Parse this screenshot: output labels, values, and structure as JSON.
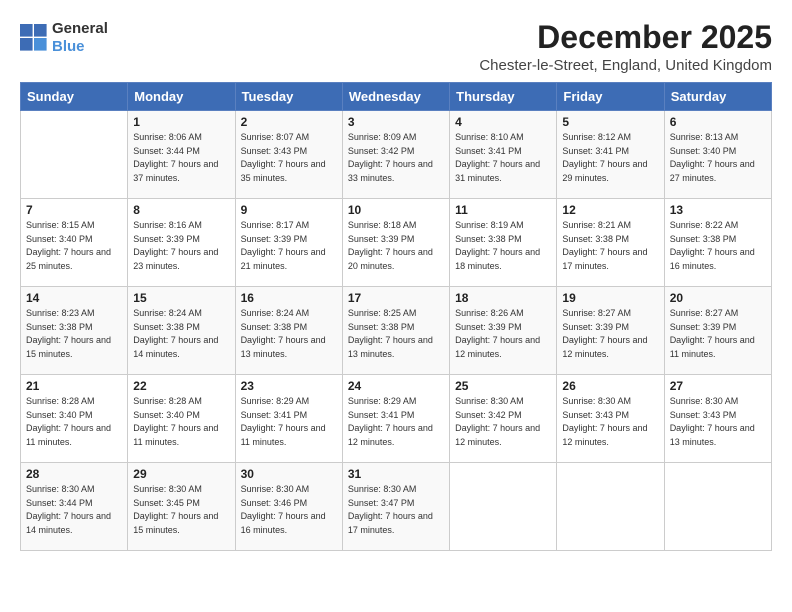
{
  "logo": {
    "general": "General",
    "blue": "Blue"
  },
  "header": {
    "title": "December 2025",
    "subtitle": "Chester-le-Street, England, United Kingdom"
  },
  "days_of_week": [
    "Sunday",
    "Monday",
    "Tuesday",
    "Wednesday",
    "Thursday",
    "Friday",
    "Saturday"
  ],
  "weeks": [
    [
      {
        "day": "",
        "sunrise": "",
        "sunset": "",
        "daylight": ""
      },
      {
        "day": "1",
        "sunrise": "Sunrise: 8:06 AM",
        "sunset": "Sunset: 3:44 PM",
        "daylight": "Daylight: 7 hours and 37 minutes."
      },
      {
        "day": "2",
        "sunrise": "Sunrise: 8:07 AM",
        "sunset": "Sunset: 3:43 PM",
        "daylight": "Daylight: 7 hours and 35 minutes."
      },
      {
        "day": "3",
        "sunrise": "Sunrise: 8:09 AM",
        "sunset": "Sunset: 3:42 PM",
        "daylight": "Daylight: 7 hours and 33 minutes."
      },
      {
        "day": "4",
        "sunrise": "Sunrise: 8:10 AM",
        "sunset": "Sunset: 3:41 PM",
        "daylight": "Daylight: 7 hours and 31 minutes."
      },
      {
        "day": "5",
        "sunrise": "Sunrise: 8:12 AM",
        "sunset": "Sunset: 3:41 PM",
        "daylight": "Daylight: 7 hours and 29 minutes."
      },
      {
        "day": "6",
        "sunrise": "Sunrise: 8:13 AM",
        "sunset": "Sunset: 3:40 PM",
        "daylight": "Daylight: 7 hours and 27 minutes."
      }
    ],
    [
      {
        "day": "7",
        "sunrise": "Sunrise: 8:15 AM",
        "sunset": "Sunset: 3:40 PM",
        "daylight": "Daylight: 7 hours and 25 minutes."
      },
      {
        "day": "8",
        "sunrise": "Sunrise: 8:16 AM",
        "sunset": "Sunset: 3:39 PM",
        "daylight": "Daylight: 7 hours and 23 minutes."
      },
      {
        "day": "9",
        "sunrise": "Sunrise: 8:17 AM",
        "sunset": "Sunset: 3:39 PM",
        "daylight": "Daylight: 7 hours and 21 minutes."
      },
      {
        "day": "10",
        "sunrise": "Sunrise: 8:18 AM",
        "sunset": "Sunset: 3:39 PM",
        "daylight": "Daylight: 7 hours and 20 minutes."
      },
      {
        "day": "11",
        "sunrise": "Sunrise: 8:19 AM",
        "sunset": "Sunset: 3:38 PM",
        "daylight": "Daylight: 7 hours and 18 minutes."
      },
      {
        "day": "12",
        "sunrise": "Sunrise: 8:21 AM",
        "sunset": "Sunset: 3:38 PM",
        "daylight": "Daylight: 7 hours and 17 minutes."
      },
      {
        "day": "13",
        "sunrise": "Sunrise: 8:22 AM",
        "sunset": "Sunset: 3:38 PM",
        "daylight": "Daylight: 7 hours and 16 minutes."
      }
    ],
    [
      {
        "day": "14",
        "sunrise": "Sunrise: 8:23 AM",
        "sunset": "Sunset: 3:38 PM",
        "daylight": "Daylight: 7 hours and 15 minutes."
      },
      {
        "day": "15",
        "sunrise": "Sunrise: 8:24 AM",
        "sunset": "Sunset: 3:38 PM",
        "daylight": "Daylight: 7 hours and 14 minutes."
      },
      {
        "day": "16",
        "sunrise": "Sunrise: 8:24 AM",
        "sunset": "Sunset: 3:38 PM",
        "daylight": "Daylight: 7 hours and 13 minutes."
      },
      {
        "day": "17",
        "sunrise": "Sunrise: 8:25 AM",
        "sunset": "Sunset: 3:38 PM",
        "daylight": "Daylight: 7 hours and 13 minutes."
      },
      {
        "day": "18",
        "sunrise": "Sunrise: 8:26 AM",
        "sunset": "Sunset: 3:39 PM",
        "daylight": "Daylight: 7 hours and 12 minutes."
      },
      {
        "day": "19",
        "sunrise": "Sunrise: 8:27 AM",
        "sunset": "Sunset: 3:39 PM",
        "daylight": "Daylight: 7 hours and 12 minutes."
      },
      {
        "day": "20",
        "sunrise": "Sunrise: 8:27 AM",
        "sunset": "Sunset: 3:39 PM",
        "daylight": "Daylight: 7 hours and 11 minutes."
      }
    ],
    [
      {
        "day": "21",
        "sunrise": "Sunrise: 8:28 AM",
        "sunset": "Sunset: 3:40 PM",
        "daylight": "Daylight: 7 hours and 11 minutes."
      },
      {
        "day": "22",
        "sunrise": "Sunrise: 8:28 AM",
        "sunset": "Sunset: 3:40 PM",
        "daylight": "Daylight: 7 hours and 11 minutes."
      },
      {
        "day": "23",
        "sunrise": "Sunrise: 8:29 AM",
        "sunset": "Sunset: 3:41 PM",
        "daylight": "Daylight: 7 hours and 11 minutes."
      },
      {
        "day": "24",
        "sunrise": "Sunrise: 8:29 AM",
        "sunset": "Sunset: 3:41 PM",
        "daylight": "Daylight: 7 hours and 12 minutes."
      },
      {
        "day": "25",
        "sunrise": "Sunrise: 8:30 AM",
        "sunset": "Sunset: 3:42 PM",
        "daylight": "Daylight: 7 hours and 12 minutes."
      },
      {
        "day": "26",
        "sunrise": "Sunrise: 8:30 AM",
        "sunset": "Sunset: 3:43 PM",
        "daylight": "Daylight: 7 hours and 12 minutes."
      },
      {
        "day": "27",
        "sunrise": "Sunrise: 8:30 AM",
        "sunset": "Sunset: 3:43 PM",
        "daylight": "Daylight: 7 hours and 13 minutes."
      }
    ],
    [
      {
        "day": "28",
        "sunrise": "Sunrise: 8:30 AM",
        "sunset": "Sunset: 3:44 PM",
        "daylight": "Daylight: 7 hours and 14 minutes."
      },
      {
        "day": "29",
        "sunrise": "Sunrise: 8:30 AM",
        "sunset": "Sunset: 3:45 PM",
        "daylight": "Daylight: 7 hours and 15 minutes."
      },
      {
        "day": "30",
        "sunrise": "Sunrise: 8:30 AM",
        "sunset": "Sunset: 3:46 PM",
        "daylight": "Daylight: 7 hours and 16 minutes."
      },
      {
        "day": "31",
        "sunrise": "Sunrise: 8:30 AM",
        "sunset": "Sunset: 3:47 PM",
        "daylight": "Daylight: 7 hours and 17 minutes."
      },
      {
        "day": "",
        "sunrise": "",
        "sunset": "",
        "daylight": ""
      },
      {
        "day": "",
        "sunrise": "",
        "sunset": "",
        "daylight": ""
      },
      {
        "day": "",
        "sunrise": "",
        "sunset": "",
        "daylight": ""
      }
    ]
  ]
}
